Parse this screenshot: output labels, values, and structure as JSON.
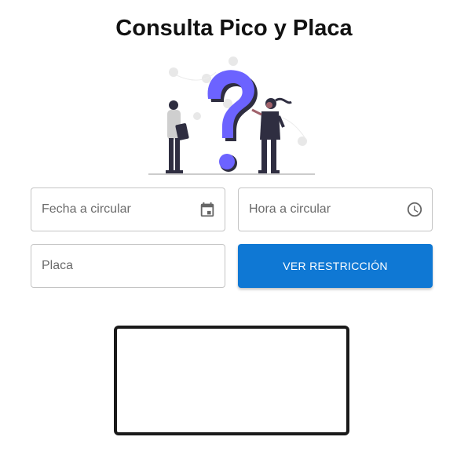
{
  "header": {
    "title": "Consulta Pico y Placa"
  },
  "illustration": {
    "name": "question-mark-people-illustration",
    "accent": "#6c63ff"
  },
  "form": {
    "date_field": {
      "placeholder": "Fecha a circular",
      "icon": "calendar-icon"
    },
    "time_field": {
      "placeholder": "Hora a circular",
      "icon": "clock-icon"
    },
    "plate_field": {
      "placeholder": "Placa"
    },
    "submit_button": {
      "label": "VER RESTRICCIÓN",
      "color": "#0f78d4"
    }
  },
  "result": {
    "text": ""
  }
}
